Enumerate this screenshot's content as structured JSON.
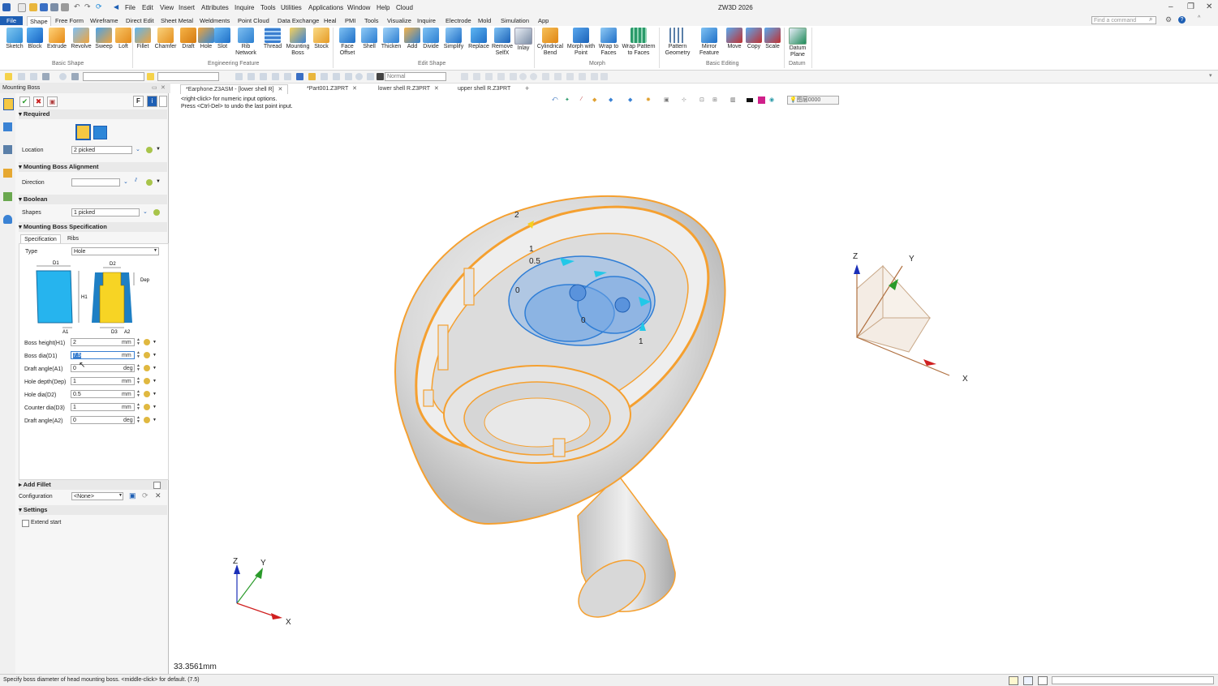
{
  "app": {
    "title": "ZW3D 2026",
    "menus": [
      "File",
      "Edit",
      "View",
      "Insert",
      "Attributes",
      "Inquire",
      "Tools",
      "Utilities",
      "Applications",
      "Window",
      "Help",
      "Cloud"
    ],
    "search_placeholder": "Find a command"
  },
  "ribbon": {
    "tabs": [
      "File",
      "Shape",
      "Free Form",
      "Wireframe",
      "Direct Edit",
      "Sheet Metal",
      "Weldments",
      "Point Cloud",
      "Data Exchange",
      "Heal",
      "PMI",
      "Tools",
      "Visualize",
      "Inquire",
      "Electrode",
      "Mold",
      "Simulation",
      "App"
    ],
    "active_tab": "Shape",
    "groups": {
      "basic_shape": "Basic Shape",
      "engineering_feature": "Engineering Feature",
      "edit_shape": "Edit Shape",
      "morph": "Morph",
      "basic_editing": "Basic Editing",
      "datum": "Datum"
    },
    "buttons": {
      "sketch": "Sketch",
      "block": "Block",
      "extrude": "Extrude",
      "revolve": "Revolve",
      "sweep": "Sweep",
      "loft": "Loft",
      "fillet": "Fillet",
      "chamfer": "Chamfer",
      "draft": "Draft",
      "hole": "Hole",
      "slot": "Slot",
      "rib_network_1": "Rib",
      "rib_network_2": "Network",
      "thread": "Thread",
      "mounting_boss_1": "Mounting",
      "mounting_boss_2": "Boss",
      "stock": "Stock",
      "face_offset_1": "Face",
      "face_offset_2": "Offset",
      "shell": "Shell",
      "thicken": "Thicken",
      "add": "Add",
      "divide": "Divide",
      "simplify": "Simplify",
      "replace": "Replace",
      "remove_selfx_1": "Remove",
      "remove_selfx_2": "SelfX",
      "inlay": "Inlay",
      "cyl_bend_1": "Cylindrical",
      "cyl_bend_2": "Bend",
      "morph_point_1": "Morph with",
      "morph_point_2": "Point",
      "wrap_faces_1": "Wrap to",
      "wrap_faces_2": "Faces",
      "wrap_pattern_1": "Wrap Pattern",
      "wrap_pattern_2": "to Faces",
      "pattern_geom_1": "Pattern",
      "pattern_geom_2": "Geometry",
      "mirror_feat_1": "Mirror",
      "mirror_feat_2": "Feature",
      "move": "Move",
      "copy": "Copy",
      "scale": "Scale",
      "datum_plane_1": "Datum",
      "datum_plane_2": "Plane"
    }
  },
  "toolbar2": {
    "style_select": "Normal"
  },
  "doc_tabs": [
    "*Earphone.Z3ASM - [lower shell R]",
    "*Part001.Z3PRT",
    "lower shell R.Z3PRT",
    "upper shell R.Z3PRT"
  ],
  "panel": {
    "title": "Mounting Boss",
    "sections": {
      "required": "Required",
      "alignment": "Mounting Boss Alignment",
      "boolean": "Boolean",
      "spec": "Mounting Boss Specification",
      "add_fillet": "Add Fillet",
      "settings": "Settings"
    },
    "location_label": "Location",
    "location_value": "2 picked",
    "direction_label": "Direction",
    "direction_value": "",
    "shapes_label": "Shapes",
    "shapes_value": "1 picked",
    "subtabs": [
      "Specification",
      "Ribs"
    ],
    "type_label": "Type",
    "type_value": "Hole",
    "diagram_labels": {
      "d1": "D1",
      "d2": "D2",
      "h1": "H1",
      "dep": "Dep",
      "a1": "A1",
      "d3": "D3",
      "a2": "A2"
    },
    "params": [
      {
        "label": "Boss height(H1)",
        "value": "2",
        "unit": "mm"
      },
      {
        "label": "Boss dia(D1)",
        "value": "7.5",
        "unit": "mm"
      },
      {
        "label": "Draft angle(A1)",
        "value": "0",
        "unit": "deg"
      },
      {
        "label": "Hole depth(Dep)",
        "value": "1",
        "unit": "mm"
      },
      {
        "label": "Hole dia(D2)",
        "value": "0.5",
        "unit": "mm"
      },
      {
        "label": "Counter dia(D3)",
        "value": "1",
        "unit": "mm"
      },
      {
        "label": "Draft angle(A2)",
        "value": "0",
        "unit": "deg"
      }
    ],
    "config_label": "Configuration",
    "config_value": "<None>",
    "extend_start": "Extend start"
  },
  "viewport": {
    "hint1": "<right-click> for numeric input options.",
    "hint2": "Press <Ctrl-Del> to undo the last point input.",
    "measure": "33.3561mm",
    "layer_field": "图层0000",
    "dims": {
      "d2": "2",
      "d1": "1",
      "d05": "0.5",
      "d0a": "0",
      "d0b": "0",
      "d1b": "1"
    },
    "triad": {
      "x": "X",
      "y": "Y",
      "z": "Z"
    }
  },
  "status": {
    "text": "Specify boss diameter of head mounting boss.  <middle-click> for default. (7.5)"
  },
  "colors": {
    "brand_blue": "#1e5fb4",
    "model_orange": "#f5a030",
    "boss_blue": "#3d86d8",
    "x_axis": "#d02020",
    "y_axis": "#2a9a2a",
    "z_axis": "#1a2fb8"
  }
}
